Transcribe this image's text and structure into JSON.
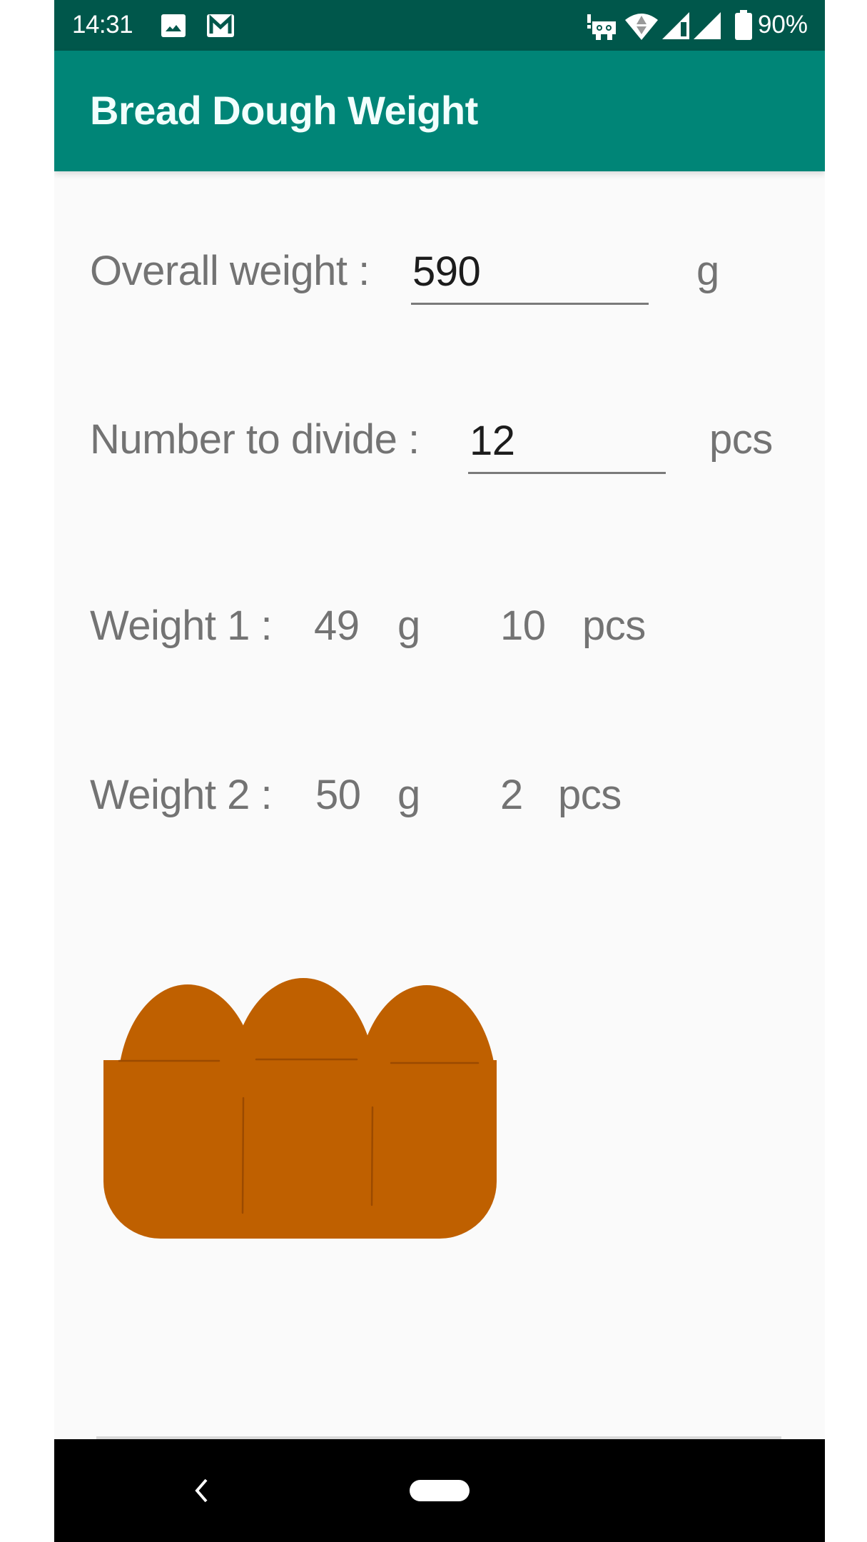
{
  "status_bar": {
    "time": "14:31",
    "left_icons": [
      "gallery-notification-icon",
      "gmail-notification-icon"
    ],
    "right_icons": [
      "vpn-robot-icon",
      "wifi-icon",
      "signal-icon-1",
      "signal-icon-2",
      "battery-icon"
    ],
    "battery_percent": "90%"
  },
  "toolbar": {
    "title": "Bread Dough Weight",
    "color": "#008577",
    "status_color": "#00574b"
  },
  "form": {
    "overall_weight": {
      "label": "Overall weight :",
      "value": "590",
      "unit": "g"
    },
    "number_to_divide": {
      "label": "Number to divide :",
      "value": "12",
      "unit": "pcs"
    }
  },
  "results": [
    {
      "label": "Weight 1 :",
      "weight": "49",
      "weight_unit": "g",
      "count": "10",
      "count_unit": "pcs"
    },
    {
      "label": "Weight 2 :",
      "weight": "50",
      "weight_unit": "g",
      "count": "2",
      "count_unit": "pcs"
    }
  ],
  "illustration": {
    "name": "bread-loaf",
    "fill_color": "#bf6000",
    "line_color": "#9b4a00"
  },
  "nav_bar": {
    "buttons": [
      "back",
      "home"
    ]
  }
}
